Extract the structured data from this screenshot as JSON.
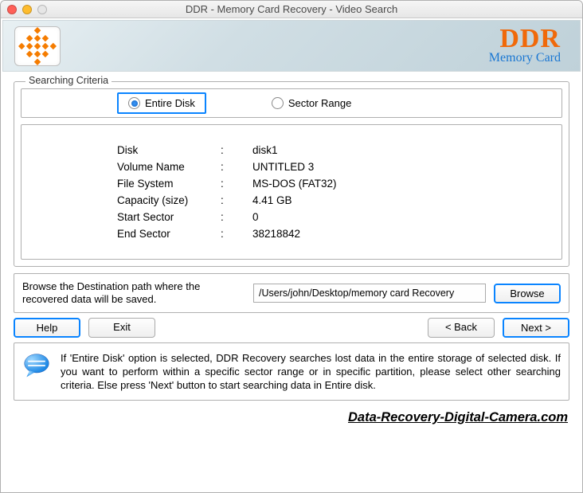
{
  "window": {
    "title": "DDR - Memory Card Recovery - Video Search"
  },
  "brand": {
    "name": "DDR",
    "subtitle": "Memory Card"
  },
  "criteria": {
    "legend": "Searching Criteria",
    "option_entire": "Entire Disk",
    "option_sector": "Sector Range"
  },
  "info": {
    "disk": {
      "label": "Disk",
      "value": "disk1"
    },
    "volume": {
      "label": "Volume Name",
      "value": "UNTITLED 3"
    },
    "fs": {
      "label": "File System",
      "value": "MS-DOS (FAT32)"
    },
    "capacity": {
      "label": "Capacity (size)",
      "value": "4.41  GB"
    },
    "start": {
      "label": "Start Sector",
      "value": "0"
    },
    "end": {
      "label": "End Sector",
      "value": "38218842"
    }
  },
  "browse": {
    "label": "Browse the Destination path where the recovered data will be saved.",
    "path": "/Users/john/Desktop/memory card Recovery",
    "button": "Browse"
  },
  "buttons": {
    "help": "Help",
    "exit": "Exit",
    "back": "< Back",
    "next": "Next >"
  },
  "hint": "If 'Entire Disk' option is selected, DDR Recovery searches lost data in the entire storage of selected disk. If you want to perform within a specific sector range or in specific partition, please select other searching criteria. Else press 'Next' button to start searching data in Entire disk.",
  "footer": "Data-Recovery-Digital-Camera.com"
}
